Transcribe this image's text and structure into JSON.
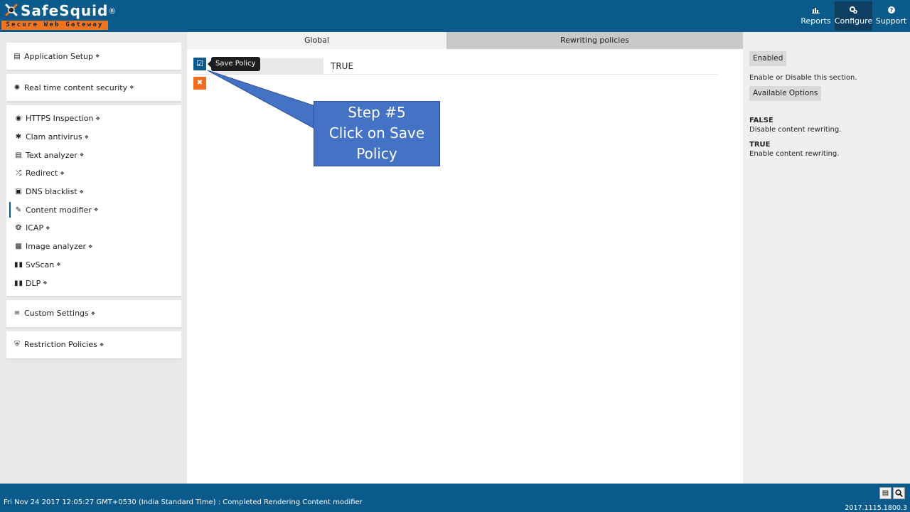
{
  "header": {
    "logo_text": "SafeSquid",
    "logo_reg": "®",
    "logo_tagline": "Secure Web Gateway",
    "nav": [
      {
        "label": "Reports",
        "icon": "chart-icon",
        "active": false
      },
      {
        "label": "Configure",
        "icon": "gears-icon",
        "active": true
      },
      {
        "label": "Support",
        "icon": "help-icon",
        "active": false
      }
    ]
  },
  "sidebar": {
    "application_setup": "Application Setup",
    "real_time": "Real time content security",
    "items": [
      {
        "label": "HTTPS Inspection",
        "icon": "eye-icon"
      },
      {
        "label": "Clam antivirus",
        "icon": "asterisk-icon"
      },
      {
        "label": "Text analyzer",
        "icon": "document-icon"
      },
      {
        "label": "Redirect",
        "icon": "shuffle-icon"
      },
      {
        "label": "DNS blacklist",
        "icon": "dns-icon"
      },
      {
        "label": "Content modifier",
        "icon": "edit-icon",
        "active": true
      },
      {
        "label": "ICAP",
        "icon": "globe-icon"
      },
      {
        "label": "Image analyzer",
        "icon": "image-file-icon"
      },
      {
        "label": "SvScan",
        "icon": "columns-icon"
      },
      {
        "label": "DLP",
        "icon": "columns-icon"
      }
    ],
    "custom_settings": "Custom Settings",
    "restriction_policies": "Restriction Policies"
  },
  "main": {
    "tabs": [
      {
        "label": "Global",
        "active": true
      },
      {
        "label": "Rewriting policies",
        "active": false
      }
    ],
    "tooltip": "Save Policy",
    "value": "TRUE",
    "callout": {
      "line1": "Step #5",
      "line2": "Click on Save",
      "line3": "Policy"
    }
  },
  "right_panel": {
    "enabled_chip": "Enabled",
    "description": "Enable or Disable this section.",
    "options_chip": "Available Options",
    "options": [
      {
        "name": "FALSE",
        "desc": "Disable content rewriting."
      },
      {
        "name": "TRUE",
        "desc": "Enable content rewriting."
      }
    ]
  },
  "footer": {
    "status": "Fri Nov 24 2017 12:05:27 GMT+0530 (India Standard Time) : Completed Rendering Content modifier",
    "version": "2017.1115.1800.3"
  },
  "colors": {
    "brand_blue": "#0a5a8c",
    "brand_orange": "#f26c1f",
    "callout_blue": "#4472c4"
  }
}
